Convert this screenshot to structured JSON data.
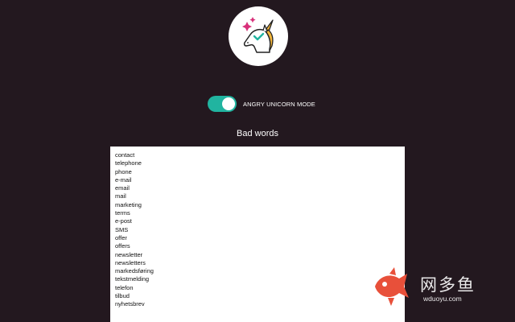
{
  "header": {
    "logo_icon": "unicorn-check-icon"
  },
  "toggle": {
    "label": "ANGRY UNICORN MODE",
    "enabled": true,
    "color": "#21b4a0"
  },
  "section": {
    "title": "Bad words"
  },
  "bad_words": [
    "contact",
    "telephone",
    "phone",
    "e-mail",
    "email",
    "mail",
    "marketing",
    "terms",
    "e-post",
    "SMS",
    "offer",
    "offers",
    "newsletter",
    "newsletters",
    "markedsføring",
    "tekstmelding",
    "telefon",
    "tilbud",
    "nyhetsbrev"
  ],
  "watermark": {
    "icon": "fish-logo-icon",
    "text": "网多鱼",
    "url": "wduoyu.com",
    "color": "#e8503a"
  }
}
